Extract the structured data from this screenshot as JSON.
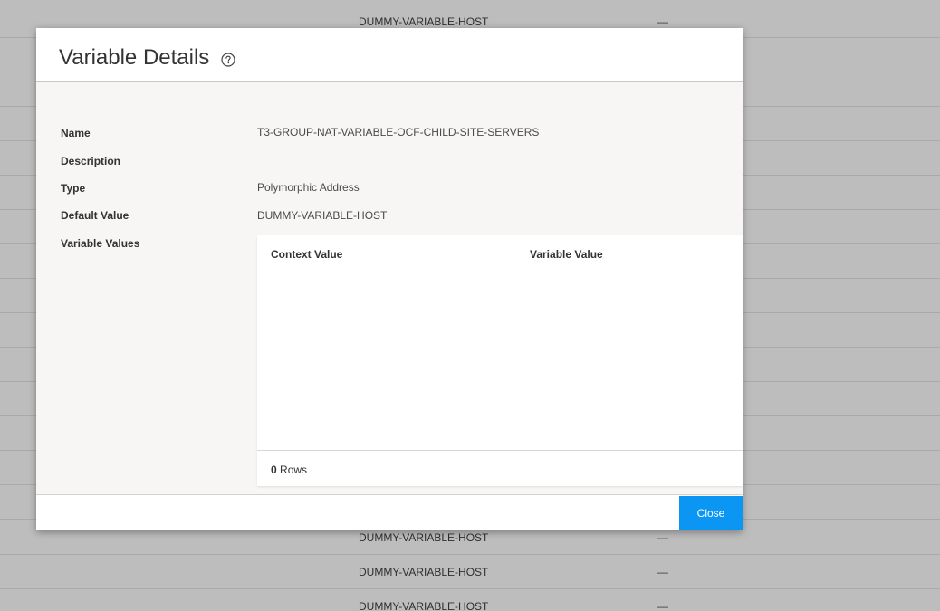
{
  "background": {
    "rows": [
      {
        "host": "DUMMY-VARIABLE-HOST",
        "dash": "—"
      },
      {
        "host": "",
        "dash": ""
      },
      {
        "host": "",
        "dash": ""
      },
      {
        "host": "",
        "dash": ""
      },
      {
        "host": "",
        "dash": ""
      },
      {
        "host": "",
        "dash": ""
      },
      {
        "host": "",
        "dash": ""
      },
      {
        "host": "",
        "dash": ""
      },
      {
        "host": "",
        "dash": ""
      },
      {
        "host": "",
        "dash": ""
      },
      {
        "host": "",
        "dash": ""
      },
      {
        "host": "",
        "dash": ""
      },
      {
        "host": "",
        "dash": ""
      },
      {
        "host": "",
        "dash": ""
      },
      {
        "host": "",
        "dash": ""
      },
      {
        "host": "DUMMY-VARIABLE-HOST",
        "dash": "—"
      },
      {
        "host": "DUMMY-VARIABLE-HOST",
        "dash": "—"
      },
      {
        "host": "DUMMY-VARIABLE-HOST",
        "dash": "—"
      }
    ]
  },
  "modal": {
    "title": "Variable Details",
    "help_icon": "question-circle-icon",
    "fields": {
      "name_label": "Name",
      "name_value": "T3-GROUP-NAT-VARIABLE-OCF-CHILD-SITE-SERVERS",
      "description_label": "Description",
      "description_value": "",
      "type_label": "Type",
      "type_value": "Polymorphic Address",
      "default_label": "Default Value",
      "default_value": "DUMMY-VARIABLE-HOST",
      "values_label": "Variable Values"
    },
    "grid": {
      "columns": [
        "Context Value",
        "Variable Value"
      ],
      "rows": [],
      "row_count": "0",
      "row_count_suffix": "Rows"
    },
    "close_label": "Close"
  },
  "colors": {
    "accent": "#0a96f2",
    "overlay": "#bdbdbd",
    "body_bg": "#f7f6f5"
  }
}
